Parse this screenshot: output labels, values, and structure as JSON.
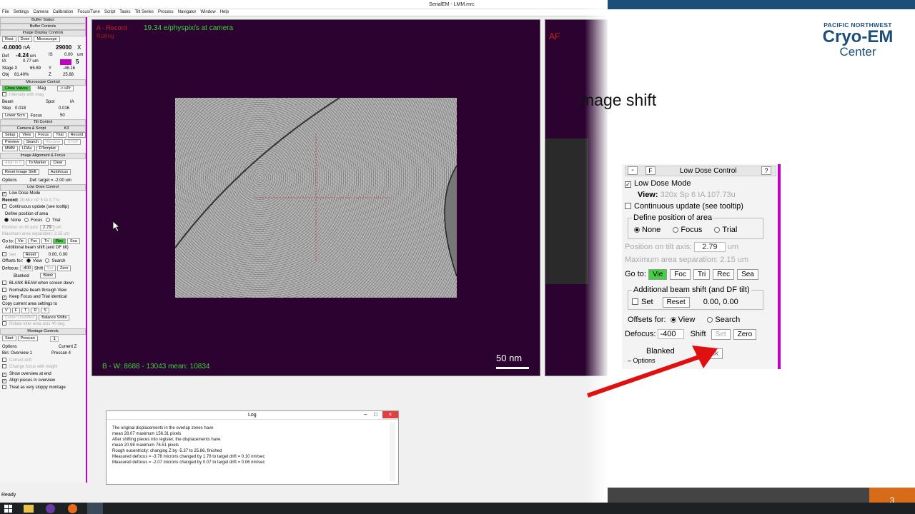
{
  "window": {
    "title": "SerialEM  -  LMM.mrc"
  },
  "menu": [
    "File",
    "Settings",
    "Camera",
    "Calibration",
    "Focus/Tune",
    "Script",
    "Tasks",
    "Tilt Series",
    "Process",
    "Navigator",
    "Window",
    "Help"
  ],
  "left_panel": {
    "buffer_status": "Buffer Status",
    "buffer_controls": "Buffer Controls",
    "image_display": "Image Display Controls",
    "tabs": [
      "Rout",
      "Dose",
      "Microscope"
    ],
    "current": "-0.0000",
    "current_unit": "nA",
    "mag": "29000",
    "mag_unit": "X",
    "def_label": "Def",
    "defocus": "-4.24",
    "def_unit": "um",
    "is_label": "IS",
    "is_value": "0.00",
    "is_unit": "um",
    "ia_label": "IA",
    "ia_value": "0.77",
    "ia_unit": "um",
    "spot": "5",
    "stage_x_label": "Stage X",
    "stage_x": "65.69",
    "y_label": "Y",
    "stage_y": "-46.16",
    "obj_label": "Obj",
    "obj": "81.40%",
    "z_label": "Z",
    "stage_z": "25.88",
    "microscope_control": "Microscope Control",
    "close_valves": "Close Valves",
    "mag_label": "Mag",
    "to_upr": "-> uPr",
    "intensity_mag": "Intensity with mag",
    "beam": "Beam",
    "spot_label": "Spot",
    "ia2": "IA",
    "step_label": "Step",
    "step1": "0.018",
    "step2": "0.016",
    "lower_scrn": "Lower Scrn",
    "focus_label": "Focus",
    "focus_val": "50",
    "tilt_control": "Tilt Control",
    "camera_script": "Camera & Script",
    "k3": "K3",
    "cam_buttons": [
      "Setup",
      "View",
      "Focus",
      "Trial",
      "Record"
    ],
    "cam_buttons2": [
      "Preview",
      "Search",
      "Resume",
      "STOP"
    ],
    "cam_buttons3": [
      "MMM",
      "LDAu",
      "DTemplat"
    ],
    "image_alignment": "Image Alignment & Focus",
    "align_to": "Align to 0",
    "to_marker": "To Marker",
    "clear": "Clear",
    "reset_image_shift": "Reset Image Shift",
    "autofocus": "Autofocus",
    "options": "Options",
    "def_target": "Def. target = -2.00 um",
    "low_dose_control": "Low Dose Control",
    "low_dose_mode": "Low Dose Mode",
    "record_label": "Record:",
    "record_info": "29.6Kx  nP 5  IA 0.77u",
    "continuous_update": "Continuous update (see tooltip)",
    "define_position": "Define position of area",
    "areas": [
      "None",
      "Focus",
      "Trial"
    ],
    "position_tilt": "Position on tilt axis:",
    "position_val": "2.79",
    "um": "um",
    "max_sep": "Maximum area separation: 2.15 um",
    "goto": "Go to:",
    "goto_buttons": [
      "Vie",
      "Foc",
      "Tri",
      "Rec",
      "Sea"
    ],
    "additional_shift": "Additional beam shift (and DF tilt)",
    "set": "Set",
    "reset": "Reset",
    "shift_val": "0.00, 0.00",
    "offsets_for": "Offsets for:",
    "view": "View",
    "search": "Search",
    "defocus_label": "Defocus:",
    "defocus_val": "-400",
    "shift_label": "Shift",
    "set2": "Set",
    "zero": "Zero",
    "blanked": "Blanked",
    "blank": "Blank",
    "blank_beam": "BLANK BEAM when screen down",
    "normalize": "Normalize beam through View",
    "keep_focus": "Keep Focus and Trial identical",
    "copy_settings": "Copy current area settings to",
    "copy_buttons": [
      "V",
      "F",
      "T",
      "R",
      "S"
    ],
    "center_unshifted": "Center Unshifted",
    "balance_shifts": "Balance Shifts",
    "rotate_inter": "Rotate inter-area axis",
    "rotate_val": "40",
    "deg": "deg",
    "montage_controls": "Montage Controls",
    "start": "Start",
    "prescan": "Prescan",
    "current_z": "Current Z",
    "mz_val": "1",
    "bin_label": "Bin: Overview 1",
    "prescan4": "Prescan 4",
    "correct_drift": "Correct drift",
    "change_focus": "Change focus with height",
    "show_overview": "Show overview at end",
    "align_pieces": "Align pieces in overview",
    "treat_sloppy": "Treat as very sloppy montage"
  },
  "image": {
    "buffer": "A - Record",
    "rolling": "Rolling",
    "dose": "19.34 e/physpix/s at camera",
    "stats": "B - W: 8688 - 13043   mean: 10834",
    "scale": "50 nm",
    "second_buffer": "AF"
  },
  "log": {
    "title": "Log",
    "lines": [
      "The original displacements in the overlap zones have",
      "mean  28.07    maximum   156.31    pixels",
      "After shifting pieces into register, the displacements have",
      "mean  20.98    maximum   76.51    pixels",
      "Rough eucentricity: changing Z by -5.37 to 25.86, finished",
      "Measured defocus = -3.78 microns    changed by 1.78 to target    drift = 0.10 nm/sec",
      "Measured defocus = -2.07 microns    changed by 0.07 to target    drift = 0.06 nm/sec"
    ]
  },
  "status": "Ready",
  "slide": {
    "logo_line1": "PACIFIC NORTHWEST",
    "logo_line2": "Cryo-EM",
    "logo_line3": "Center",
    "heading": "mage shift",
    "page": "3"
  },
  "zoom_panel": {
    "title": "Low Dose Control",
    "low_dose_mode": "Low Dose Mode",
    "view_label": "View:",
    "view_info": "320x  Sp 6  IA 107.73u",
    "continuous_update": "Continuous update (see tooltip)",
    "define_position": "Define position of area",
    "areas": [
      "None",
      "Focus",
      "Trial"
    ],
    "position_tilt": "Position on tilt axis:",
    "position_val": "2.79",
    "um": "um",
    "max_sep": "Maximum area separation: 2.15 um",
    "goto": "Go to:",
    "goto_buttons": [
      "Vie",
      "Foc",
      "Tri",
      "Rec",
      "Sea"
    ],
    "additional_shift": "Additional beam shift (and DF tilt)",
    "set": "Set",
    "reset": "Reset",
    "shift_val": "0.00, 0.00",
    "offsets_for": "Offsets for:",
    "view": "View",
    "search": "Search",
    "defocus_label": "Defocus:",
    "defocus_val": "-400",
    "shift_label": "Shift",
    "set2": "Set",
    "zero": "Zero",
    "blanked": "Blanked",
    "options": "Options",
    "blank": "Blank",
    "help": "?",
    "minus": "-",
    "f": "F"
  },
  "colors": {
    "accent": "#c000c0",
    "image_bg": "#2c0330",
    "green_btn": "#44d044",
    "orange": "#d66c1a",
    "logo_blue": "#1b4f7a",
    "arrow": "#e01010"
  }
}
